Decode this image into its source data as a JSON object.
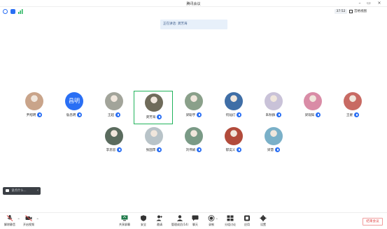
{
  "window": {
    "title": "腾讯会议"
  },
  "infobar": {
    "timer": "37:52",
    "view_label": "宫格视图"
  },
  "speaking": {
    "text": "正在讲话: 龚芳海"
  },
  "participants": [
    {
      "name": "尹旭明",
      "avatar": "photo",
      "color": "#c9a48a"
    },
    {
      "name": "詹昌明",
      "avatar": "text",
      "avatar_text": "昌明"
    },
    {
      "name": "王超",
      "avatar": "photo",
      "color": "#a2a49a"
    },
    {
      "name": "龚芳海",
      "avatar": "photo",
      "color": "#6f6b5a",
      "active": true
    },
    {
      "name": "梁聪宇",
      "avatar": "photo",
      "color": "#8aa08a"
    },
    {
      "name": "何灿灯",
      "avatar": "photo",
      "color": "#3f6ea6"
    },
    {
      "name": "朱秋群",
      "avatar": "photo",
      "color": "#c9c2d8"
    },
    {
      "name": "梁观知",
      "avatar": "photo",
      "color": "#d98ca6"
    },
    {
      "name": "王翟",
      "avatar": "photo",
      "color": "#c86a63"
    },
    {
      "name": "李思思",
      "avatar": "photo",
      "color": "#5a6b5e"
    },
    {
      "name": "张国萍",
      "avatar": "photo",
      "color": "#b8c3c8"
    },
    {
      "name": "刘伟娟",
      "avatar": "photo",
      "color": "#7a9a86"
    },
    {
      "name": "郁奕义",
      "avatar": "photo",
      "color": "#b24b3b"
    },
    {
      "name": "梁慧",
      "avatar": "photo",
      "color": "#7ab0c8"
    }
  ],
  "chat": {
    "placeholder": "说点什么..."
  },
  "toolbar": {
    "mute": "解除静音",
    "video": "开启视频",
    "share": "共享屏幕",
    "security": "安全",
    "invite": "邀请",
    "members": "管理成员(14)",
    "chat": "聊天",
    "record": "录制",
    "apps": "分组讨论",
    "stats": "应用",
    "settings": "设置",
    "end": "结束会议"
  }
}
